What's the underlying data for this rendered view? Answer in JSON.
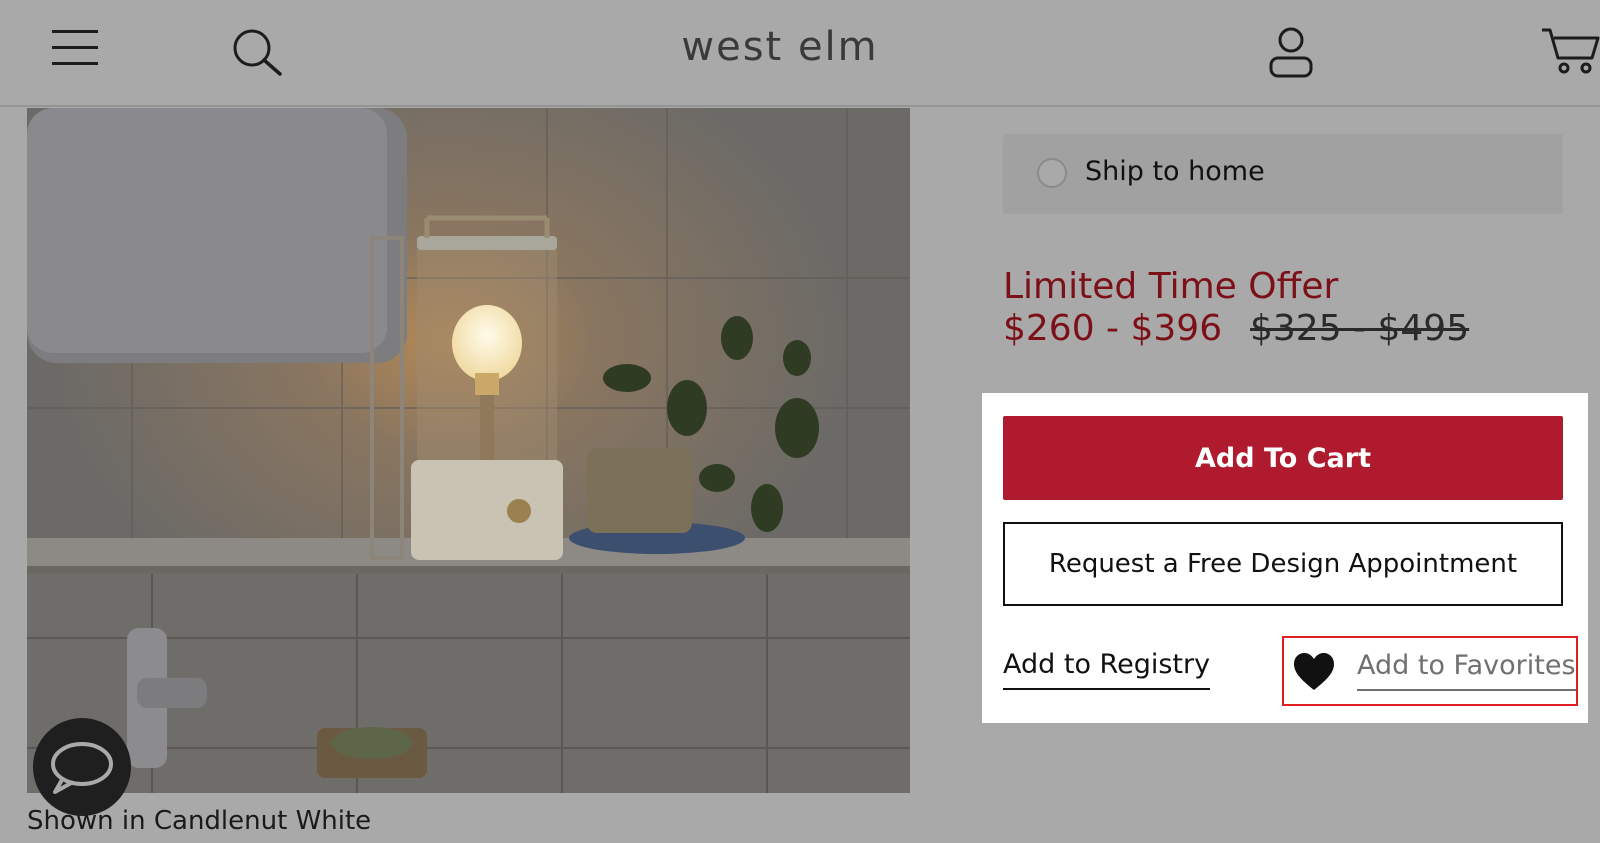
{
  "header": {
    "logo": "west elm",
    "icons": [
      "menu-icon",
      "search-icon",
      "account-icon",
      "cart-icon"
    ]
  },
  "product": {
    "caption": "Shown in Candlenut White"
  },
  "shipping": {
    "option_label": "Ship to home",
    "selected": false
  },
  "pricing": {
    "offer_label": "Limited Time Offer",
    "sale_price": "$260 - $396",
    "original_price": "$325 - $495"
  },
  "actions": {
    "add_to_cart": "Add To Cart",
    "design_appointment": "Request a Free Design Appointment",
    "add_to_registry": "Add to Registry",
    "add_to_favorites": "Add to Favorites"
  },
  "colors": {
    "brand_red": "#b01a2f",
    "price_red": "#7c1018",
    "highlight_red": "#e02020"
  }
}
